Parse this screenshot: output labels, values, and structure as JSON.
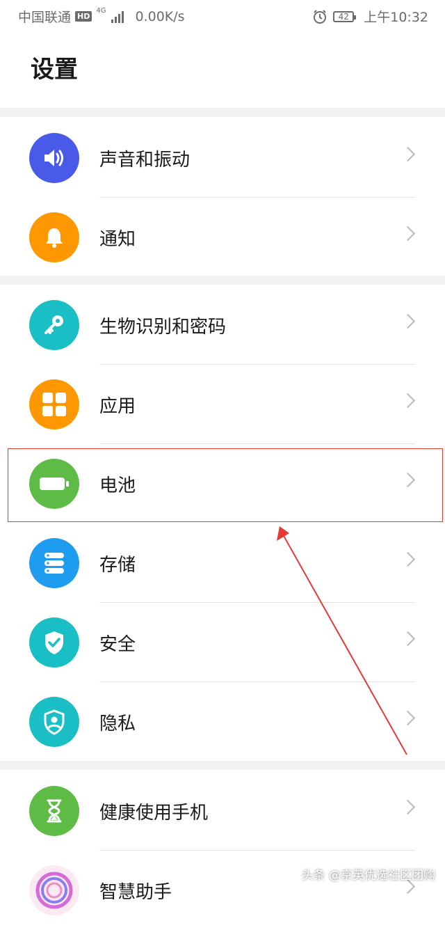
{
  "status_bar": {
    "carrier": "中国联通",
    "hd": "HD",
    "network": "4G",
    "speed": "0.00K/s",
    "battery": "42",
    "time": "上午10:32"
  },
  "page": {
    "title": "设置"
  },
  "groups": [
    {
      "items": [
        {
          "label": "声音和振动",
          "icon": "speaker-icon",
          "color": "#4a5ae8"
        },
        {
          "label": "通知",
          "icon": "bell-icon",
          "color": "#ff9800"
        }
      ]
    },
    {
      "items": [
        {
          "label": "生物识别和密码",
          "icon": "key-icon",
          "color": "#19bfc4"
        },
        {
          "label": "应用",
          "icon": "apps-grid-icon",
          "color": "#ff9800"
        },
        {
          "label": "电池",
          "icon": "battery-icon",
          "color": "#5dbb46"
        },
        {
          "label": "存储",
          "icon": "storage-icon",
          "color": "#1e9cf0"
        },
        {
          "label": "安全",
          "icon": "shield-check-icon",
          "color": "#19bfc4"
        },
        {
          "label": "隐私",
          "icon": "privacy-shield-icon",
          "color": "#19bfc4"
        }
      ]
    },
    {
      "items": [
        {
          "label": "健康使用手机",
          "icon": "hourglass-icon",
          "color": "#5dbb46"
        },
        {
          "label": "智慧助手",
          "icon": "assistant-icon",
          "color": "#b06ad8"
        }
      ]
    }
  ],
  "annotation": {
    "highlight_color": "#e53935"
  },
  "watermark": "头条 @京英优选社区团购"
}
